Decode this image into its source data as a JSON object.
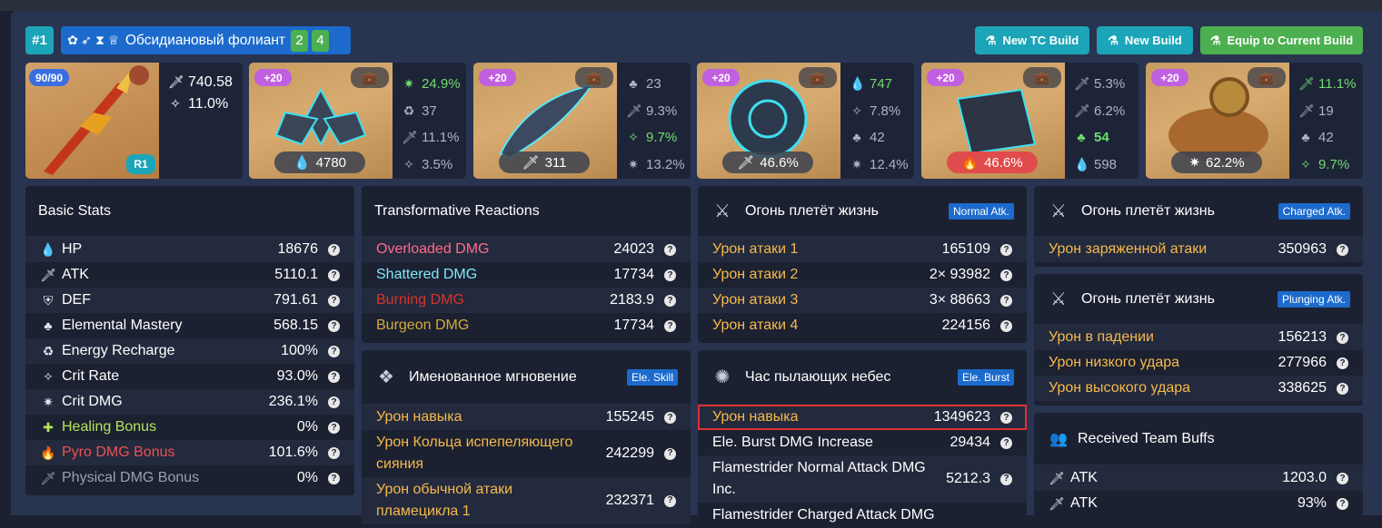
{
  "header": {
    "build_index": "#1",
    "set_name": "Обсидиановый фолиант",
    "set_icons": [
      "flower-icon",
      "feather-icon",
      "sands-icon",
      "goblet-icon"
    ],
    "count_a": "2",
    "count_b": "4",
    "new_tc_label": "New TC Build",
    "new_build_label": "New Build",
    "equip_label": "Equip to Current Build",
    "colors": {
      "teal": "#1ca5b8",
      "blue": "#1c6bcc",
      "green": "#4caf50"
    }
  },
  "weapon": {
    "level": "90/90",
    "refine": "R1",
    "atk": "740.58",
    "sub": "11.0%"
  },
  "artifacts": [
    {
      "level": "+20",
      "main": "4780",
      "main_icon": "hp-icon",
      "subs": [
        "24.9%",
        "37",
        "11.1%",
        "3.5%"
      ]
    },
    {
      "level": "+20",
      "main": "311",
      "main_icon": "atk-icon",
      "subs": [
        "23",
        "9.3%",
        "9.7%",
        "13.2%"
      ]
    },
    {
      "level": "+20",
      "main": "46.6%",
      "main_icon": "atk-percent-icon",
      "subs": [
        "747",
        "7.8%",
        "42",
        "12.4%"
      ]
    },
    {
      "level": "+20",
      "main": "46.6%",
      "main_icon": "pyro-icon",
      "subs": [
        "5.3%",
        "6.2%",
        "54",
        "598"
      ]
    },
    {
      "level": "+20",
      "main": "62.2%",
      "main_icon": "crit-dmg-icon",
      "subs": [
        "11.1%",
        "19",
        "42",
        "9.7%"
      ]
    }
  ],
  "basic": {
    "title": "Basic Stats",
    "rows": [
      {
        "label": "HP",
        "value": "18676"
      },
      {
        "label": "ATK",
        "value": "5110.1"
      },
      {
        "label": "DEF",
        "value": "791.61"
      },
      {
        "label": "Elemental Mastery",
        "value": "568.15"
      },
      {
        "label": "Energy Recharge",
        "value": "100%"
      },
      {
        "label": "Crit Rate",
        "value": "93.0%"
      },
      {
        "label": "Crit DMG",
        "value": "236.1%"
      },
      {
        "label": "Healing Bonus",
        "value": "0%"
      },
      {
        "label": "Pyro DMG Bonus",
        "value": "101.6%"
      },
      {
        "label": "Physical DMG Bonus",
        "value": "0%"
      }
    ]
  },
  "transformative": {
    "title": "Transformative Reactions",
    "rows": [
      {
        "label": "Overloaded DMG",
        "value": "24023"
      },
      {
        "label": "Shattered DMG",
        "value": "17734"
      },
      {
        "label": "Burning DMG",
        "value": "2183.9"
      },
      {
        "label": "Burgeon DMG",
        "value": "17734"
      }
    ]
  },
  "skill": {
    "title": "Именованное мгновение",
    "badge": "Ele. Skill",
    "rows": [
      {
        "label": "Урон навыка",
        "value": "155245"
      },
      {
        "label": "Урон Кольца испепеляющего сияния",
        "value": "242299"
      },
      {
        "label": "Урон обычной атаки пламецикла 1",
        "value": "232371"
      }
    ]
  },
  "normal": {
    "title": "Огонь плетёт жизнь",
    "badge": "Normal Atk.",
    "rows": [
      {
        "label": "Урон атаки 1",
        "value": "165109"
      },
      {
        "label": "Урон атаки 2",
        "value": "2× 93982"
      },
      {
        "label": "Урон атаки 3",
        "value": "3× 88663"
      },
      {
        "label": "Урон атаки 4",
        "value": "224156"
      }
    ]
  },
  "burst": {
    "title": "Час пылающих небес",
    "badge": "Ele. Burst",
    "rows": [
      {
        "label": "Урон навыка",
        "value": "1349623"
      },
      {
        "label": "Ele. Burst DMG Increase",
        "value": "29434"
      },
      {
        "label": "Flamestrider Normal Attack DMG Inc.",
        "value": "5212.3"
      },
      {
        "label": "Flamestrider Charged Attack DMG",
        "value": ""
      }
    ]
  },
  "charged": {
    "title": "Огонь плетёт жизнь",
    "badge": "Charged Atk.",
    "rows": [
      {
        "label": "Урон заряженной атаки",
        "value": "350963"
      }
    ]
  },
  "plunging": {
    "title": "Огонь плетёт жизнь",
    "badge": "Plunging Atk.",
    "rows": [
      {
        "label": "Урон в падении",
        "value": "156213"
      },
      {
        "label": "Урон низкого удара",
        "value": "277966"
      },
      {
        "label": "Урон высокого удара",
        "value": "338625"
      }
    ]
  },
  "team": {
    "title": "Received Team Buffs",
    "rows": [
      {
        "label": "ATK",
        "value": "1203.0"
      },
      {
        "label": "ATK",
        "value": "93%"
      }
    ]
  }
}
